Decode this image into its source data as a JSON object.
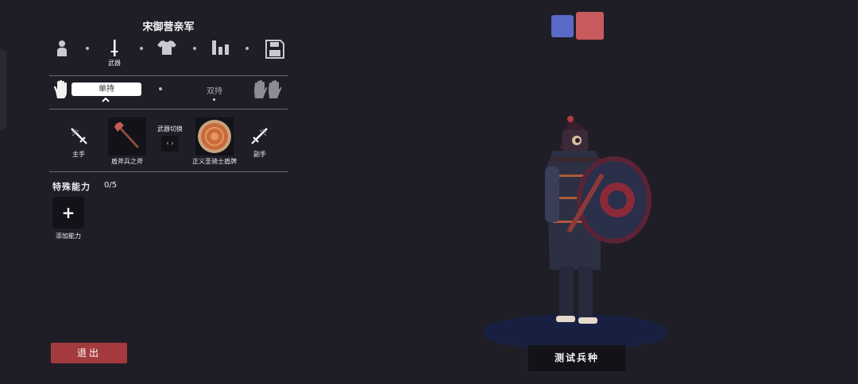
{
  "unit": {
    "title": "宋御营亲军"
  },
  "tabs": {
    "weapon_label": "武器"
  },
  "grip": {
    "single": "单持",
    "dual": "双持"
  },
  "weapons": {
    "main_hand_label": "主手",
    "off_hand_label": "副手",
    "main_weapon_name": "盾斧兵之斧",
    "off_weapon_name": "正义圣骑士盾牌",
    "swap_label": "武器切换",
    "swap_icon": "‹ ›"
  },
  "abilities": {
    "title": "特殊能力",
    "count": "0/5",
    "add_symbol": "+",
    "add_label": "添加能力"
  },
  "buttons": {
    "exit": "退出",
    "test": "测试兵种"
  },
  "colors": {
    "team_blue": "#5a6ac8",
    "team_red": "#c95a5d",
    "exit": "#a43a3d",
    "background": "#1f1e27"
  }
}
